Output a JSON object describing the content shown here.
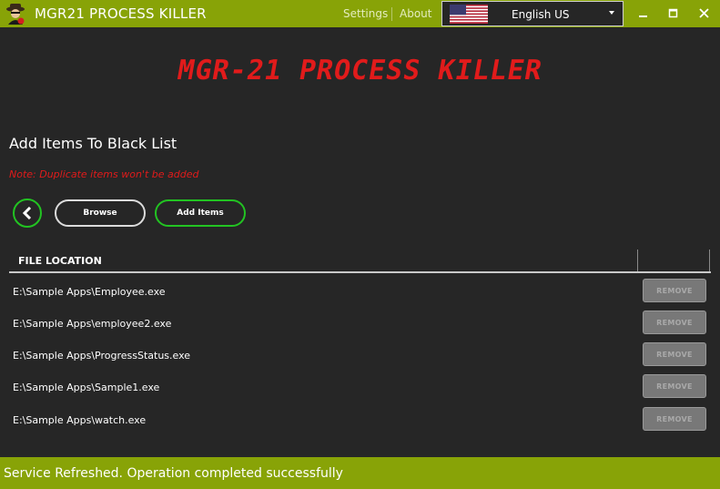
{
  "window": {
    "title": "MGR21 PROCESS KILLER",
    "settings_label": "Settings",
    "about_label": "About",
    "language": "English US",
    "accent_color": "#88a307"
  },
  "logo_title": "MGR-21 PROCESS KILLER",
  "page": {
    "heading": "Add Items To Black List",
    "note": "Note: Duplicate items won't be added"
  },
  "actions": {
    "browse_label": "Browse",
    "add_items_label": "Add Items"
  },
  "table": {
    "column_header": "FILE LOCATION",
    "remove_label": "REMOVE",
    "rows": [
      "E:\\Sample Apps\\Employee.exe",
      "E:\\Sample Apps\\employee2.exe",
      "E:\\Sample Apps\\ProgressStatus.exe",
      "E:\\Sample Apps\\Sample1.exe",
      "E:\\Sample Apps\\watch.exe"
    ]
  },
  "status": {
    "message": "Service Refreshed. Operation completed successfully"
  },
  "icons": [
    "app-icon",
    "us-flag-icon",
    "dropdown-arrow-icon",
    "minimize-icon",
    "maximize-icon",
    "close-icon",
    "back-arrow-icon"
  ]
}
